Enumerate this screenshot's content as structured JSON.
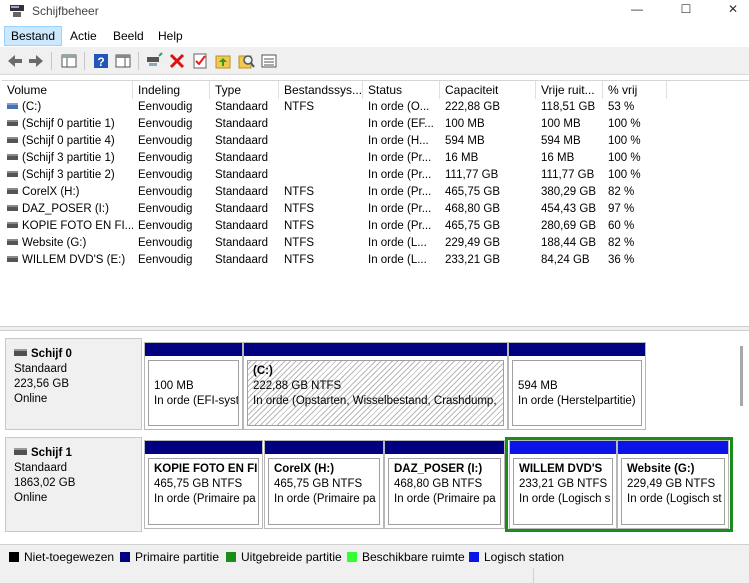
{
  "window": {
    "title": "Schijfbeheer",
    "minimize": "—",
    "maximize": "☐",
    "close": "✕"
  },
  "menu": [
    {
      "label": "Bestand"
    },
    {
      "label": "Actie"
    },
    {
      "label": "Beeld"
    },
    {
      "label": "Help"
    }
  ],
  "toolbar": {
    "items": [
      "back-icon",
      "forward-icon",
      "console-tree-icon",
      "help-icon",
      "show-pane-icon",
      "connect-icon",
      "delete-icon",
      "properties-icon",
      "folder-up-icon",
      "search-icon",
      "list-icon"
    ]
  },
  "list": {
    "columns": [
      "Volume",
      "Indeling",
      "Type",
      "Bestandssys...",
      "Status",
      "Capaciteit",
      "Vrije ruit...",
      "% vrij"
    ],
    "rows": [
      [
        "(C:)",
        "Eenvoudig",
        "Standaard",
        "NTFS",
        "In orde (O...",
        "222,88 GB",
        "118,51 GB",
        "53 %"
      ],
      [
        "(Schijf 0 partitie 1)",
        "Eenvoudig",
        "Standaard",
        "",
        "In orde (EF...",
        "100 MB",
        "100 MB",
        "100 %"
      ],
      [
        "(Schijf 0 partitie 4)",
        "Eenvoudig",
        "Standaard",
        "",
        "In orde (H...",
        "594 MB",
        "594 MB",
        "100 %"
      ],
      [
        "(Schijf 3 partitie 1)",
        "Eenvoudig",
        "Standaard",
        "",
        "In orde (Pr...",
        "16 MB",
        "16 MB",
        "100 %"
      ],
      [
        "(Schijf 3 partitie 2)",
        "Eenvoudig",
        "Standaard",
        "",
        "In orde (Pr...",
        "111,77 GB",
        "111,77 GB",
        "100 %"
      ],
      [
        "CorelX (H:)",
        "Eenvoudig",
        "Standaard",
        "NTFS",
        "In orde (Pr...",
        "465,75 GB",
        "380,29 GB",
        "82 %"
      ],
      [
        "DAZ_POSER (I:)",
        "Eenvoudig",
        "Standaard",
        "NTFS",
        "In orde (Pr...",
        "468,80 GB",
        "454,43 GB",
        "97 %"
      ],
      [
        "KOPIE FOTO EN FI...",
        "Eenvoudig",
        "Standaard",
        "NTFS",
        "In orde (Pr...",
        "465,75 GB",
        "280,69 GB",
        "60 %"
      ],
      [
        "Website (G:)",
        "Eenvoudig",
        "Standaard",
        "NTFS",
        "In orde (L...",
        "229,49 GB",
        "188,44 GB",
        "82 %"
      ],
      [
        "WILLEM DVD'S  (E:)",
        "Eenvoudig",
        "Standaard",
        "NTFS",
        "In orde (L...",
        "233,21 GB",
        "84,24 GB",
        "36 %"
      ]
    ]
  },
  "disks": [
    {
      "name": "Schijf 0",
      "type": "Standaard",
      "size": "223,56 GB",
      "state": "Online",
      "partitions": [
        {
          "name": "",
          "size": "100 MB",
          "status": "In orde (EFI-syst"
        },
        {
          "name": "(C:)",
          "size": "222,88 GB NTFS",
          "status": "In orde (Opstarten, Wisselbestand, Crashdump,"
        },
        {
          "name": "",
          "size": "594 MB",
          "status": "In orde (Herstelpartitie)"
        }
      ]
    },
    {
      "name": "Schijf 1",
      "type": "Standaard",
      "size": "1863,02 GB",
      "state": "Online",
      "partitions": [
        {
          "name": "KOPIE FOTO EN FIL",
          "size": "465,75 GB NTFS",
          "status": "In orde (Primaire pa"
        },
        {
          "name": "CorelX  (H:)",
          "size": "465,75 GB NTFS",
          "status": "In orde (Primaire pa"
        },
        {
          "name": "DAZ_POSER  (I:)",
          "size": "468,80 GB NTFS",
          "status": "In orde (Primaire pa"
        },
        {
          "name": "WILLEM DVD'S",
          "size": "233,21 GB NTFS",
          "status": "In orde (Logisch s"
        },
        {
          "name": "Website  (G:)",
          "size": "229,49 GB NTFS",
          "status": "In orde (Logisch st"
        }
      ]
    }
  ],
  "legend": [
    {
      "label": "Niet-toegewezen",
      "color": "#000000"
    },
    {
      "label": "Primaire partitie",
      "color": "#000080"
    },
    {
      "label": "Uitgebreide partitie",
      "color": "#1a8c1a"
    },
    {
      "label": "Beschikbare ruimte",
      "color": "#33ff33"
    },
    {
      "label": "Logisch station",
      "color": "#0a14e6"
    }
  ]
}
